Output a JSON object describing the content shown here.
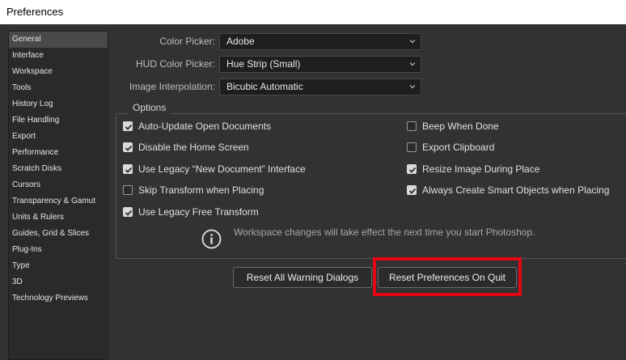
{
  "window": {
    "title": "Preferences"
  },
  "sidebar": {
    "items": [
      {
        "label": "General",
        "selected": true
      },
      {
        "label": "Interface"
      },
      {
        "label": "Workspace"
      },
      {
        "label": "Tools"
      },
      {
        "label": "History Log"
      },
      {
        "label": "File Handling"
      },
      {
        "label": "Export"
      },
      {
        "label": "Performance"
      },
      {
        "label": "Scratch Disks"
      },
      {
        "label": "Cursors"
      },
      {
        "label": "Transparency & Gamut"
      },
      {
        "label": "Units & Rulers"
      },
      {
        "label": "Guides, Grid & Slices"
      },
      {
        "label": "Plug-Ins"
      },
      {
        "label": "Type"
      },
      {
        "label": "3D"
      },
      {
        "label": "Technology Previews"
      }
    ]
  },
  "general": {
    "color_picker": {
      "label": "Color Picker:",
      "value": "Adobe"
    },
    "hud_color_picker": {
      "label": "HUD Color Picker:",
      "value": "Hue Strip (Small)"
    },
    "image_interpolation": {
      "label": "Image Interpolation:",
      "value": "Bicubic Automatic"
    }
  },
  "options": {
    "title": "Options",
    "left": [
      {
        "label": "Auto-Update Open Documents",
        "checked": true
      },
      {
        "label": "Disable the Home Screen",
        "checked": true
      },
      {
        "label": "Use Legacy “New Document” Interface",
        "checked": true
      },
      {
        "label": "Skip Transform when Placing",
        "checked": false
      },
      {
        "label": "Use Legacy Free Transform",
        "checked": true
      }
    ],
    "right": [
      {
        "label": "Beep When Done",
        "checked": false
      },
      {
        "label": "Export Clipboard",
        "checked": false
      },
      {
        "label": "Resize Image During Place",
        "checked": true
      },
      {
        "label": "Always Create Smart Objects when Placing",
        "checked": true
      }
    ],
    "info_text": "Workspace changes will take effect the next time you start Photoshop."
  },
  "buttons": {
    "reset_warnings": "Reset All Warning Dialogs",
    "reset_prefs": "Reset Preferences On Quit"
  },
  "colors": {
    "background": "#323232",
    "highlight": "#e30613"
  }
}
